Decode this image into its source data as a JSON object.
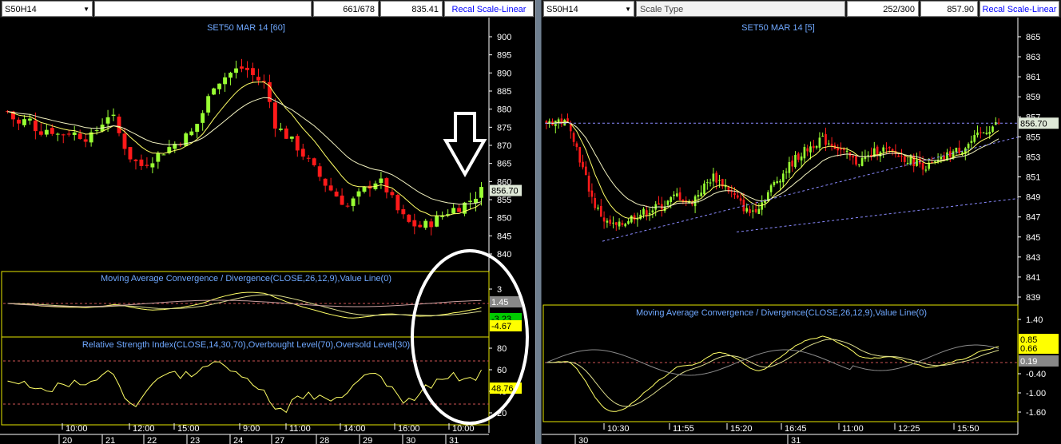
{
  "colors": {
    "bull": "#99ff33",
    "bear": "#ff1a1a",
    "ma": "#ffff66",
    "ma2": "#f2f2c0",
    "title": "#6fa8ff",
    "axis_text": "#ffffff",
    "box_border": "#e6e600",
    "dashed_level": "#cc5555",
    "trend_line": "#8a8aff",
    "annotation": "#ffffff"
  },
  "left": {
    "toolbar": {
      "symbol": "S50H14",
      "position": "661/678",
      "price": "835.41",
      "recal": "Recal Scale-Linear"
    },
    "price_panel": {
      "title": "SET50 MAR 14   [60]",
      "y_ticks": [
        "900",
        "895",
        "890",
        "885",
        "880",
        "875",
        "870",
        "865",
        "860",
        "855",
        "850",
        "845",
        "840"
      ],
      "last_price": "856.70"
    },
    "macd_panel": {
      "title": "Moving Average Convergence / Divergence(CLOSE,26,12,9),Value Line(0)",
      "y_ticks": [
        "3"
      ],
      "labels": [
        "1.45",
        "-3.23",
        "-4.67"
      ]
    },
    "rsi_panel": {
      "title": "Relative Strength Index(CLOSE,14,30,70),Overbought Level(70),Oversold Level(30)",
      "y_ticks": [
        "80",
        "60",
        "40",
        "20"
      ],
      "last": "48.76"
    },
    "time_labels": [
      "10:00",
      "12:00",
      "15:00",
      "9:00",
      "11:00",
      "14:00",
      "16:00",
      "10:00"
    ],
    "date_labels": [
      "20",
      "21",
      "22",
      "23",
      "24",
      "27",
      "28",
      "29",
      "30",
      "31"
    ]
  },
  "right": {
    "toolbar": {
      "symbol": "S50H14",
      "scale_type": "Scale Type",
      "position": "252/300",
      "price": "857.90",
      "recal": "Recal Scale-Linear"
    },
    "price_panel": {
      "title": "SET50 MAR 14   [5]",
      "y_ticks": [
        "865",
        "863",
        "861",
        "859",
        "857",
        "855",
        "853",
        "851",
        "849",
        "847",
        "845",
        "843",
        "841",
        "839"
      ],
      "last_price": "856.70"
    },
    "macd_panel": {
      "title": "Moving Average Convergence / Divergence(CLOSE,26,12,9),Value Line(0)",
      "y_ticks": [
        "1.40",
        "-0.40",
        "-1.00",
        "-1.60"
      ],
      "labels": [
        "0.85",
        "0.66",
        "0.19"
      ]
    },
    "time_labels": [
      "10:30",
      "11:55",
      "15:20",
      "16:45",
      "11:00",
      "12:25",
      "15:50"
    ],
    "date_labels": [
      "30",
      "31"
    ]
  },
  "chart_data": [
    {
      "type": "candlestick",
      "title": "SET50 MAR 14   [60]",
      "ylim": [
        838,
        902
      ],
      "closes": [
        880,
        876,
        878,
        874,
        875,
        873,
        874,
        873,
        872,
        876,
        880,
        872,
        866,
        864,
        866,
        868,
        870,
        872,
        874,
        880,
        888,
        890,
        892,
        893,
        890,
        888,
        876,
        873,
        870,
        866,
        862,
        858,
        855,
        852,
        855,
        858,
        860,
        856,
        850,
        847,
        846,
        847,
        849,
        851,
        852,
        854,
        856.7
      ]
    },
    {
      "type": "candlestick",
      "title": "SET50 MAR 14   [5]",
      "ylim": [
        838,
        866
      ],
      "closes": [
        856.8,
        857,
        856.5,
        852,
        848,
        846,
        845.5,
        846.5,
        847,
        847.5,
        848,
        849,
        848,
        849.5,
        851,
        850,
        848.5,
        847,
        848,
        850,
        851.5,
        853,
        854,
        855,
        854.5,
        853.5,
        852.5,
        853,
        854,
        853.5,
        853,
        852.5,
        852,
        852.5,
        853.5,
        854,
        855,
        856,
        856.7
      ]
    }
  ]
}
